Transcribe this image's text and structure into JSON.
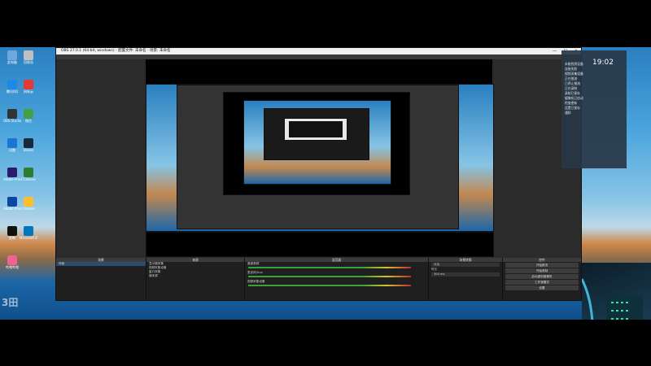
{
  "obs_window": {
    "title": "OBS 27.0.1 (64-bit, windows) - 配置文件: 未命名 - 场景: 未命名",
    "controls": {
      "minimize": "—",
      "maximize": "☐",
      "close": "✕"
    }
  },
  "desktop_icons": [
    {
      "label": "此电脑",
      "color": "#6fa8dc"
    },
    {
      "label": "回收站",
      "color": "#c0c0c0"
    },
    {
      "label": "腾讯QQ",
      "color": "#1e88e5"
    },
    {
      "label": "网易云",
      "color": "#e53935"
    },
    {
      "label": "OBS Studio",
      "color": "#333333"
    },
    {
      "label": "微信",
      "color": "#43a047"
    },
    {
      "label": "迅雷",
      "color": "#1976d2"
    },
    {
      "label": "Steam",
      "color": "#1b2838"
    },
    {
      "label": "Adobe Premiere Pro",
      "color": "#2b1a6e"
    },
    {
      "label": "CCleaner",
      "color": "#2e7d32"
    },
    {
      "label": "Adobe Photoshop",
      "color": "#0d47a1"
    },
    {
      "label": "Chrome",
      "color": "#fbc02d"
    },
    {
      "label": "剪映",
      "color": "#111111"
    },
    {
      "label": "Microsoft Edge",
      "color": "#0277bd"
    },
    {
      "label": "哔哩哔哩",
      "color": "#f06292"
    }
  ],
  "docks": {
    "scenes": {
      "title": "场景",
      "items": [
        "场景"
      ]
    },
    "sources": {
      "title": "来源",
      "items": [
        "显示器采集",
        "视频采集设备",
        "窗口采集",
        "媒体源"
      ]
    },
    "mixer": {
      "title": "混音器",
      "channels": [
        {
          "name": "桌面音频",
          "db": "0.0 dB"
        },
        {
          "name": "麦克风/Aux",
          "db": "0.0 dB"
        },
        {
          "name": "视频采集设备",
          "db": "0.0 dB"
        }
      ]
    },
    "transitions": {
      "title": "场景转换",
      "mode": "淡出",
      "duration_label": "时长",
      "duration": "300 ms"
    },
    "controls": {
      "title": "控件",
      "buttons": [
        "开始推流",
        "开始录制",
        "启动虚拟摄像机",
        "工作室模式",
        "设置",
        "退出"
      ]
    }
  },
  "notification": {
    "time": "19:02",
    "lines": [
      "未能找到设备",
      "连接失败",
      "视频采集设备",
      "正在推流",
      "已停止推流",
      "正在录制",
      "录制已保存",
      "摄像机已启动",
      "检查更新",
      "设置已保存",
      "通知"
    ]
  },
  "watermark": "3田",
  "taskbar": {
    "icons": [
      "start-icon",
      "search-icon",
      "taskview-icon",
      "netease-icon",
      "wechat-icon",
      "chrome-icon",
      "obs-icon",
      "explorer-icon",
      "qq-icon"
    ]
  }
}
